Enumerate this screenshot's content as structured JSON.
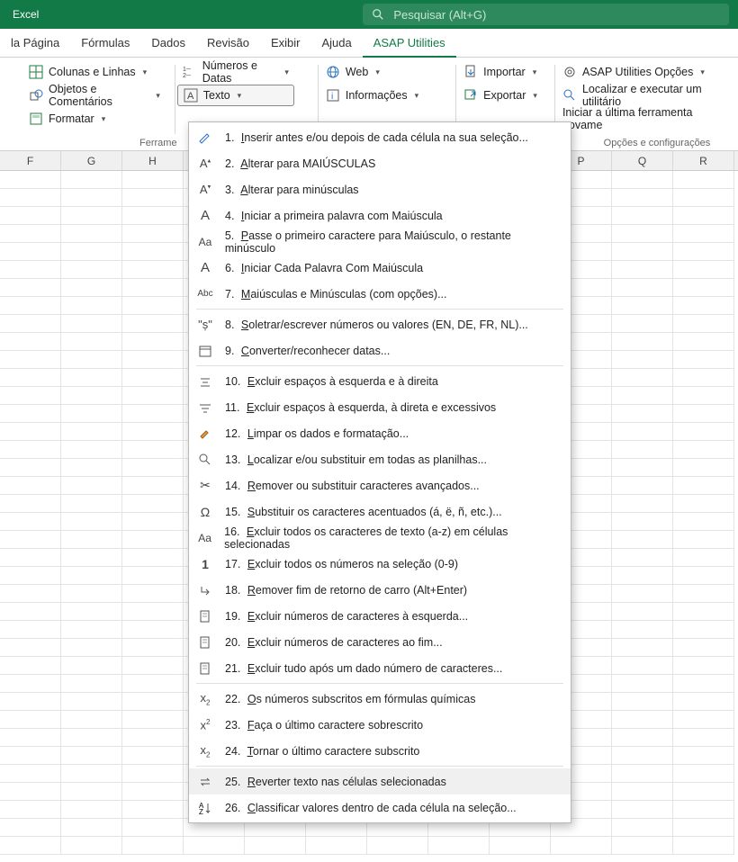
{
  "titlebar": {
    "title": "Excel",
    "search_placeholder": "Pesquisar (Alt+G)"
  },
  "tabs": {
    "items": [
      "la Página",
      "Fórmulas",
      "Dados",
      "Revisão",
      "Exibir",
      "Ajuda",
      "ASAP Utilities"
    ],
    "active_index": 6
  },
  "ribbon": {
    "group1": {
      "label": "Ferrame",
      "colunas": "Colunas e Linhas",
      "objetos": "Objetos e Comentários",
      "formatar": "Formatar"
    },
    "group2": {
      "numeros": "Números e Datas",
      "texto": "Texto",
      "web": "Web",
      "info": "Informações",
      "importar": "Importar",
      "exportar": "Exportar"
    },
    "group3": {
      "label": "Opções e configurações",
      "opcoes": "ASAP Utilities Opções",
      "localizar": "Localizar e executar um utilitário",
      "iniciar": "Iniciar a última ferramenta novame"
    }
  },
  "columns": [
    "F",
    "G",
    "H",
    "",
    "",
    "",
    "",
    "",
    "",
    "P",
    "Q",
    "R"
  ],
  "menu": {
    "items": [
      {
        "n": "1.",
        "u": "I",
        "rest": "nserir antes e/ou depois de cada célula na sua seleção...",
        "icon": "edit"
      },
      {
        "n": "2.",
        "u": "A",
        "rest": "lterar para MAIÚSCULAS",
        "icon": "Aup"
      },
      {
        "n": "3.",
        "u": "A",
        "rest": "lterar para minúsculas",
        "icon": "Adown"
      },
      {
        "n": "4.",
        "u": "I",
        "rest": "niciar a primeira palavra com Maiúscula",
        "icon": "A"
      },
      {
        "n": "5.",
        "u": "P",
        "rest": "asse o primeiro caractere para Maiúsculo, o restante minúsculo",
        "icon": "Aa"
      },
      {
        "n": "6.",
        "u": "I",
        "rest": "niciar Cada Palavra Com Maiúscula",
        "icon": "A"
      },
      {
        "n": "7.",
        "u": "M",
        "rest": "aiúsculas e Minúsculas (com opções)...",
        "icon": "Abc"
      },
      {
        "sep": true
      },
      {
        "n": "8.",
        "u": "S",
        "rest": "oletrar/escrever números ou valores (EN, DE, FR, NL)...",
        "icon": "quote"
      },
      {
        "n": "9.",
        "u": "C",
        "rest": "onverter/reconhecer datas...",
        "icon": "cal"
      },
      {
        "sep": true
      },
      {
        "n": "10.",
        "u": "E",
        "rest": "xcluir espaços à esquerda e à direita",
        "icon": "trim"
      },
      {
        "n": "11.",
        "u": "E",
        "rest": "xcluir espaços à esquerda, à direta e excessivos",
        "icon": "trim2"
      },
      {
        "n": "12.",
        "u": "L",
        "rest": "impar os dados e formatação...",
        "icon": "brush"
      },
      {
        "n": "13.",
        "u": "L",
        "rest": "ocalizar e/ou substituir em todas as planilhas...",
        "icon": "search"
      },
      {
        "n": "14.",
        "u": "R",
        "rest": "emover ou substituir caracteres avançados...",
        "icon": "scissors"
      },
      {
        "n": "15.",
        "u": "S",
        "rest": "ubstituir os caracteres acentuados (á, ë, ñ, etc.)...",
        "icon": "omega"
      },
      {
        "n": "16.",
        "u": "E",
        "rest": "xcluir todos os caracteres de texto (a-z) em células selecionadas",
        "icon": "Aa"
      },
      {
        "n": "17.",
        "u": "E",
        "rest": "xcluir todos os números na seleção (0-9)",
        "icon": "one"
      },
      {
        "n": "18.",
        "u": "R",
        "rest": "emover fim de retorno de carro (Alt+Enter)",
        "icon": "return"
      },
      {
        "n": "19.",
        "u": "E",
        "rest": "xcluir números de caracteres à esquerda...",
        "icon": "doc"
      },
      {
        "n": "20.",
        "u": "E",
        "rest": "xcluir números de caracteres ao fim...",
        "icon": "doc"
      },
      {
        "n": "21.",
        "u": "E",
        "rest": "xcluir tudo após um dado número de caracteres...",
        "icon": "doc"
      },
      {
        "sep": true
      },
      {
        "n": "22.",
        "u": "O",
        "rest": "s números subscritos em fórmulas químicas",
        "icon": "x2d"
      },
      {
        "n": "23.",
        "u": "F",
        "rest": "aça o último caractere sobrescrito",
        "icon": "x2u"
      },
      {
        "n": "24.",
        "u": "T",
        "rest": "ornar o último caractere subscrito",
        "icon": "x2d"
      },
      {
        "sep": true
      },
      {
        "n": "25.",
        "u": "R",
        "rest": "everter texto nas células selecionadas",
        "icon": "swap",
        "hover": true
      },
      {
        "n": "26.",
        "u": "C",
        "rest": "lassificar valores dentro de cada célula na seleção...",
        "icon": "sort"
      }
    ]
  }
}
